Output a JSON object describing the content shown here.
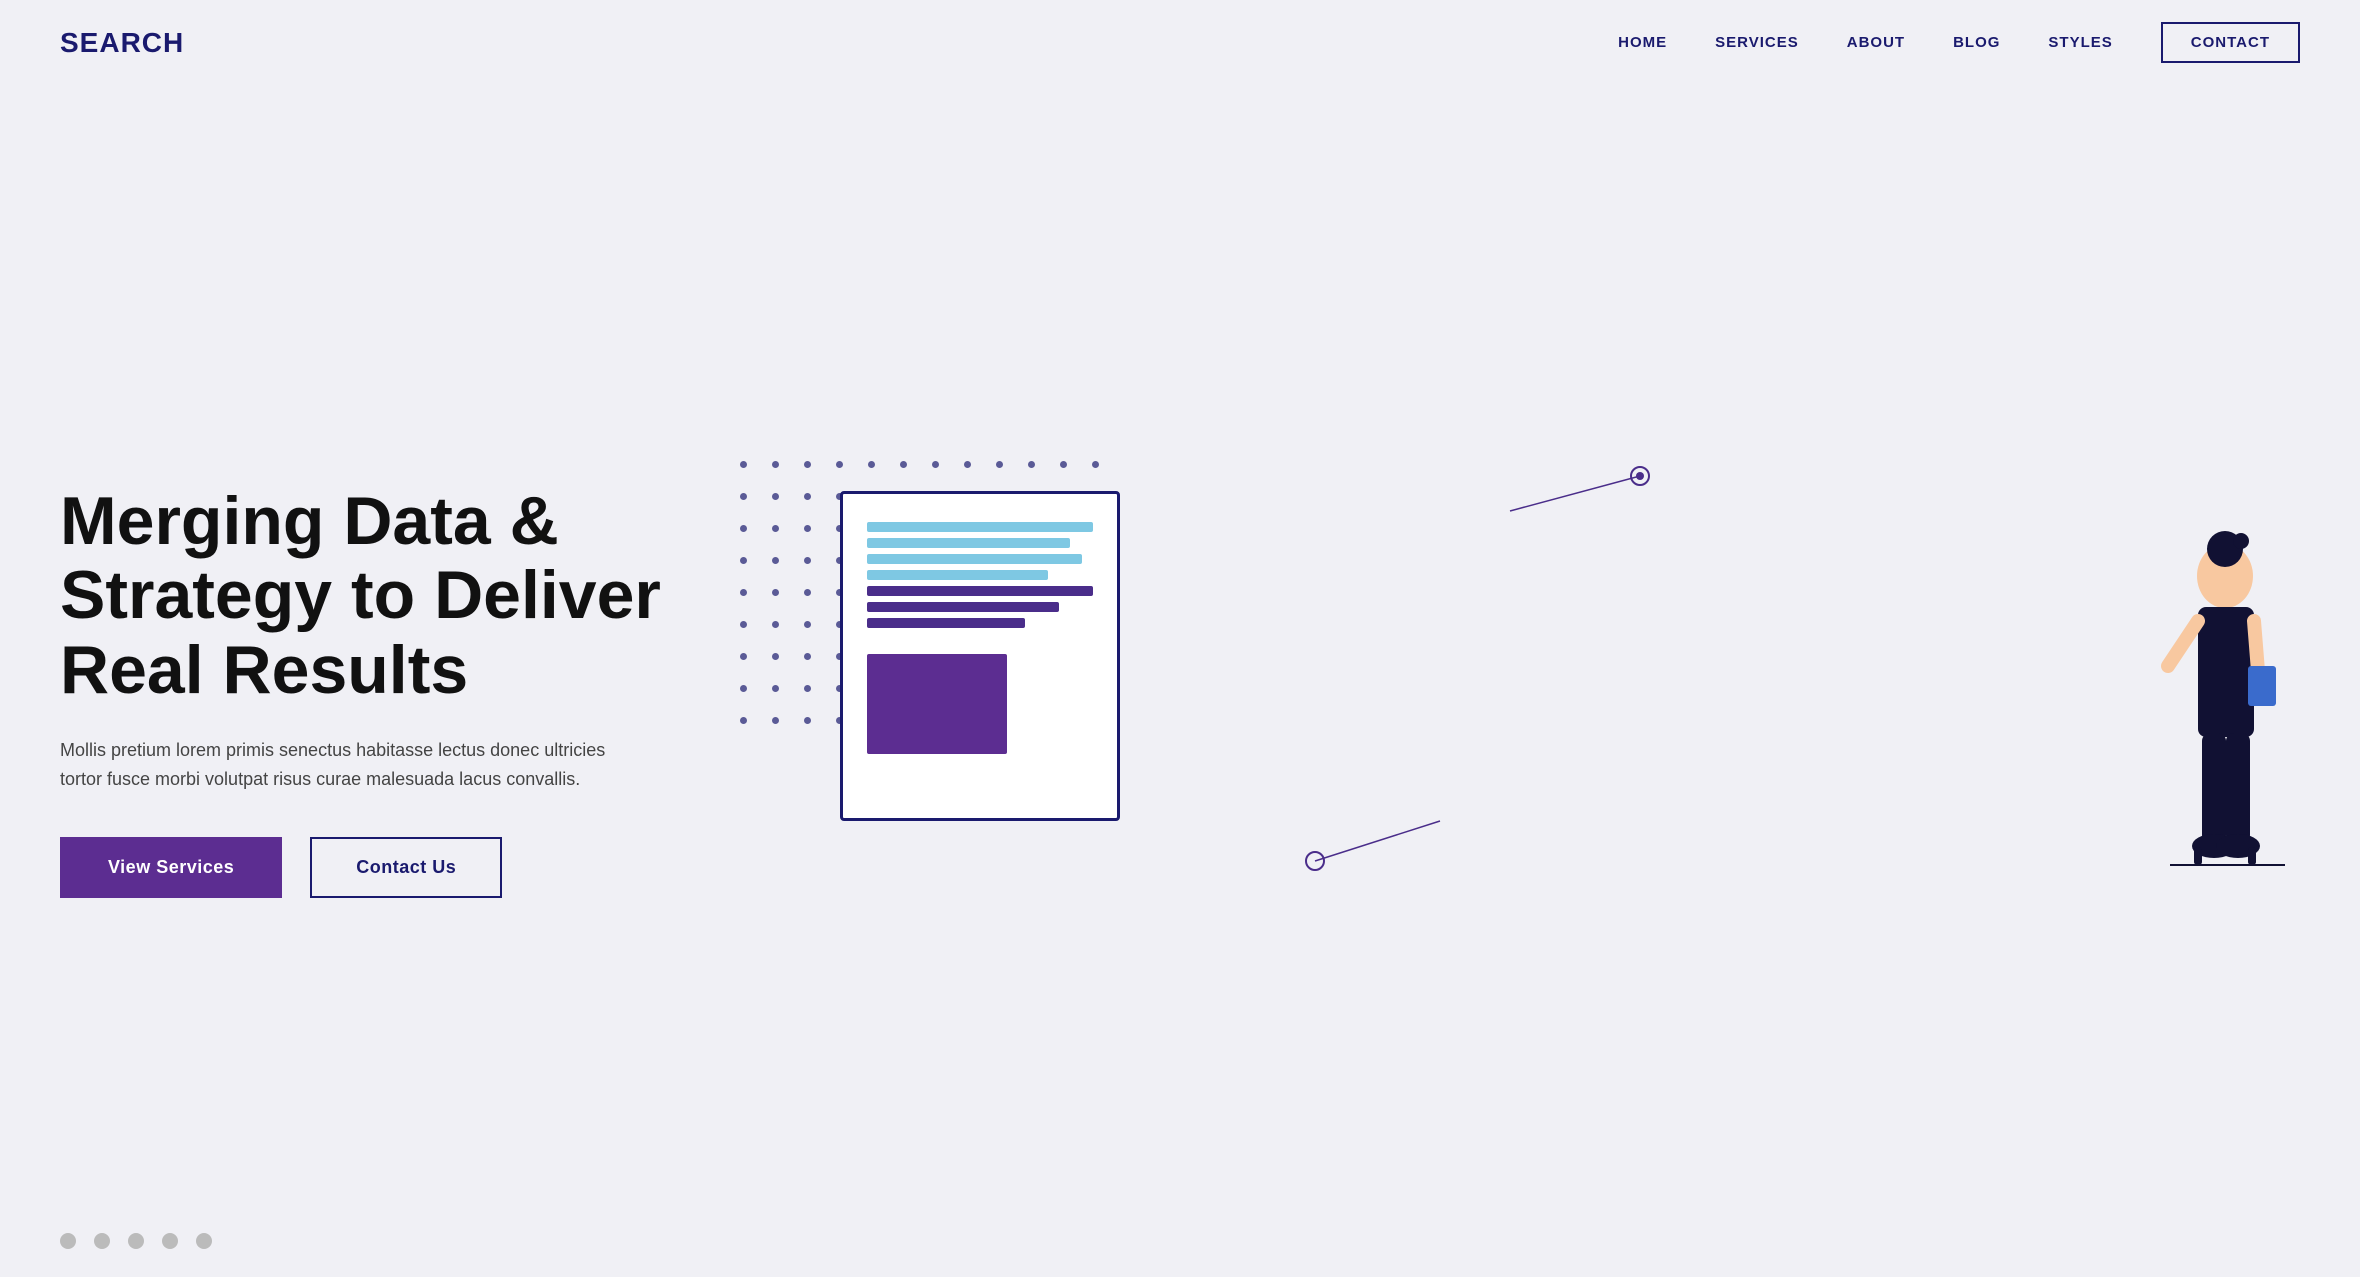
{
  "header": {
    "logo": "SEARCH",
    "nav": {
      "links": [
        {
          "label": "HOME",
          "name": "nav-home"
        },
        {
          "label": "SERVICES",
          "name": "nav-services"
        },
        {
          "label": "ABOUT",
          "name": "nav-about"
        },
        {
          "label": "BLOG",
          "name": "nav-blog"
        },
        {
          "label": "STYLES",
          "name": "nav-styles"
        }
      ],
      "contact_button": "CONTACT"
    }
  },
  "hero": {
    "title": "Merging Data & Strategy to Deliver Real Results",
    "description": "Mollis pretium lorem primis senectus habitasse lectus donec ultricies tortor fusce morbi volutpat risus curae malesuada lacus convallis.",
    "btn_primary": "View Services",
    "btn_secondary": "Contact Us"
  },
  "pagination": {
    "dots": [
      1,
      2,
      3,
      4,
      5
    ],
    "active": 1
  },
  "colors": {
    "accent_purple": "#5c2d91",
    "navy": "#1a1a6e",
    "background": "#f0f0f5",
    "light_blue": "#7ec8e3",
    "doc_border": "#1a1a6e"
  }
}
